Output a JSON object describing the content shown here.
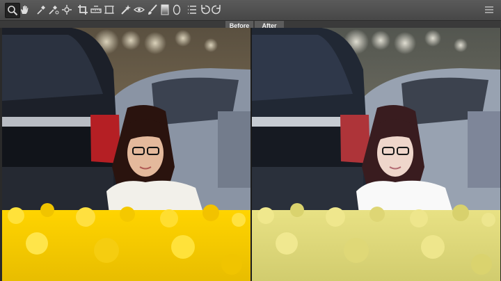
{
  "toolbar": {
    "tools": [
      {
        "icon": "zoom-icon",
        "active": true
      },
      {
        "icon": "hand-icon"
      },
      {
        "icon": "white-balance-icon"
      },
      {
        "icon": "color-sampler-icon"
      },
      {
        "icon": "targeted-adjustment-icon"
      },
      {
        "icon": "crop-icon"
      },
      {
        "icon": "straighten-icon"
      },
      {
        "icon": "transform-icon"
      },
      {
        "icon": "spot-removal-icon"
      },
      {
        "icon": "red-eye-icon"
      },
      {
        "icon": "adjustment-brush-icon"
      },
      {
        "icon": "graduated-filter-icon"
      },
      {
        "icon": "radial-filter-icon"
      },
      {
        "icon": "preferences-icon"
      },
      {
        "icon": "rotate-left-icon"
      },
      {
        "icon": "rotate-right-icon"
      },
      {
        "icon": "menu-icon"
      }
    ]
  },
  "compare": {
    "before_label": "Before",
    "after_label": "After"
  },
  "colors": {
    "toolbar_bg": "#4f4f4f",
    "panel_bg": "#2a2a2a",
    "label_bg": "#5c5c5c",
    "flowers_before": "#f2c500",
    "flowers_after": "#dfd25a"
  }
}
